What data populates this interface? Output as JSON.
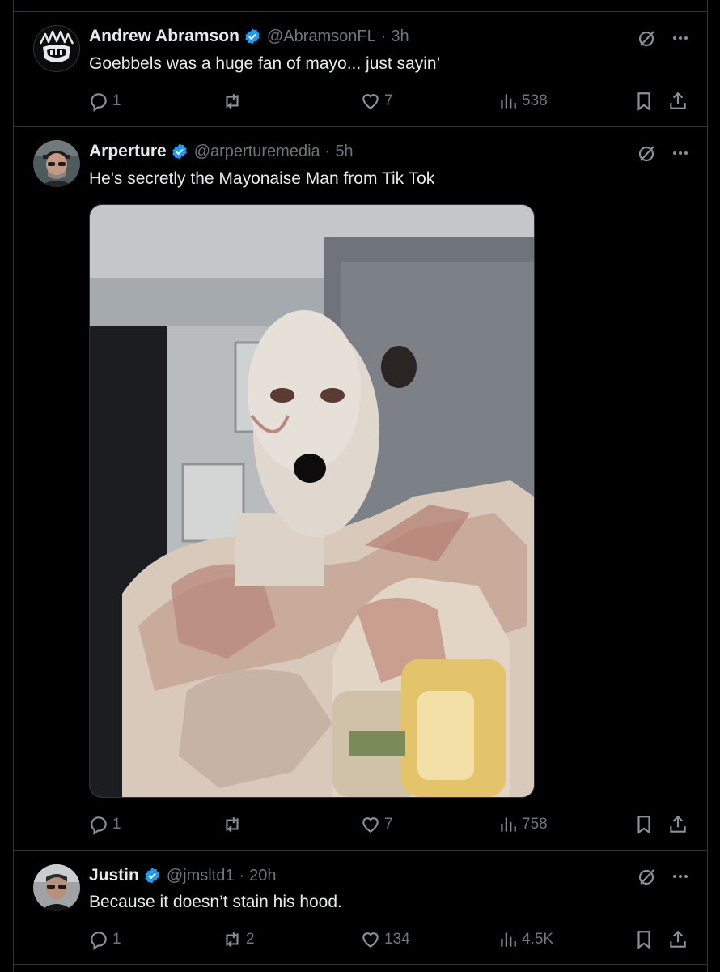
{
  "tweets": [
    {
      "name": "Andrew Abramson",
      "handle": "@AbramsonFL",
      "time": "3h",
      "text": "Goebbels was a huge fan of mayo... just sayin’",
      "replies": "1",
      "retweets": "",
      "likes": "7",
      "views": "538"
    },
    {
      "name": "Arperture",
      "handle": "@arperturemedia",
      "time": "5h",
      "text": "He's secretly the Mayonaise Man from Tik Tok",
      "replies": "1",
      "retweets": "",
      "likes": "7",
      "views": "758"
    },
    {
      "name": "Justin",
      "handle": "@jmsltd1",
      "time": "20h",
      "text": "Because it doesn’t stain his hood.",
      "replies": "1",
      "retweets": "2",
      "likes": "134",
      "views": "4.5K"
    }
  ],
  "separator": "·",
  "colors": {
    "background": "#000000",
    "text": "#e7e9ea",
    "muted": "#71767b",
    "border": "#2f3336",
    "verified": "#1d9bf0"
  }
}
